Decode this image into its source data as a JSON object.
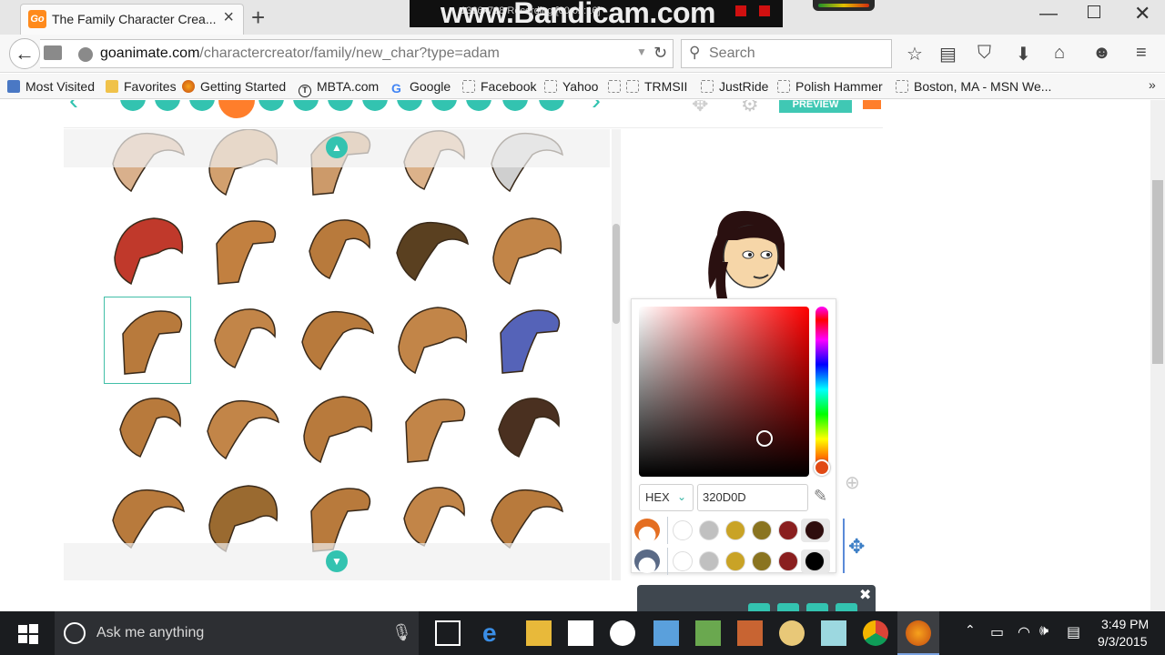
{
  "browser": {
    "tab_title": "The Family Character Crea...",
    "tab_favicon": "Go",
    "url_domain": "goanimate.com",
    "url_path": "/charactercreator/family/new_char?type=adam",
    "search_placeholder": "Search"
  },
  "overlay": {
    "watermark": "www.Bandicam.com",
    "caption": "1366x768    Recording [00:02:16]"
  },
  "bookmarks": [
    {
      "label": "Most Visited",
      "icon": "star-folder-icon"
    },
    {
      "label": "Favorites",
      "icon": "folder-icon"
    },
    {
      "label": "Getting Started",
      "icon": "firefox-icon"
    },
    {
      "label": "MBTA.com",
      "icon": "mbta-icon"
    },
    {
      "label": "Google",
      "icon": "google-icon"
    },
    {
      "label": "Facebook",
      "icon": "page-icon"
    },
    {
      "label": "Yahoo",
      "icon": "page-icon"
    },
    {
      "label": "TRMSII",
      "icon": "page-icon"
    },
    {
      "label": "JustRide",
      "icon": "page-icon"
    },
    {
      "label": "Polish Hammer",
      "icon": "page-icon"
    },
    {
      "label": "Boston, MA - MSN We...",
      "icon": "page-icon"
    }
  ],
  "creator": {
    "preview_label": "PREVIEW",
    "selected_hair_index": 10,
    "hair_colors": [
      "#d9b08c",
      "#d2a06e",
      "#cc9a6a",
      "#dcb28a",
      "#cfcfcf",
      "#c0392b",
      "#c28040",
      "#b87a3c",
      "#5a4020",
      "#c28548",
      "#b87a3c",
      "#c28548",
      "#b87a3c",
      "#c28548",
      "#5563b8",
      "#b87a3c",
      "#c28548",
      "#b87a3c",
      "#c28548",
      "#4a3020",
      "#b87a3c",
      "#9a6a30",
      "#b87a3c",
      "#c28548",
      "#b87a3c"
    ]
  },
  "color_picker": {
    "mode": "HEX",
    "hex_value": "320D0D",
    "swatches": [
      "#ffffff",
      "#c0c0c0",
      "#c9a326",
      "#8a7420",
      "#8a1f1f",
      "#2e0d0d"
    ],
    "swatches_row2": [
      "#ffffff",
      "#c0c0c0",
      "#c9a326",
      "#8a7420",
      "#8a1f1f",
      "#000000"
    ]
  },
  "taskbar": {
    "search_placeholder": "Ask me anything",
    "time": "3:49 PM",
    "date": "9/3/2015"
  }
}
